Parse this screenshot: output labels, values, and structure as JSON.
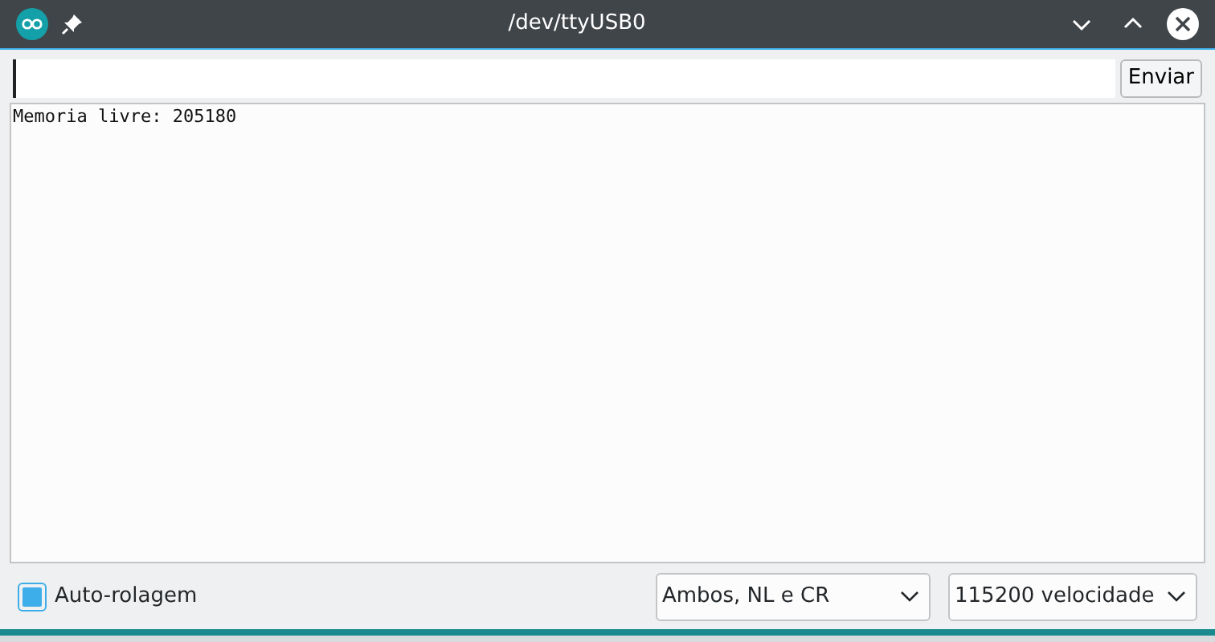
{
  "window": {
    "title": "/dev/ttyUSB0"
  },
  "send_button": "Enviar",
  "output": {
    "lines": [
      "Memoria livre: 205180"
    ]
  },
  "autoscroll": {
    "label": "Auto-rolagem",
    "checked": true
  },
  "line_ending": {
    "value": "Ambos, NL e CR"
  },
  "baud_rate": {
    "value": "115200 velocidade"
  }
}
